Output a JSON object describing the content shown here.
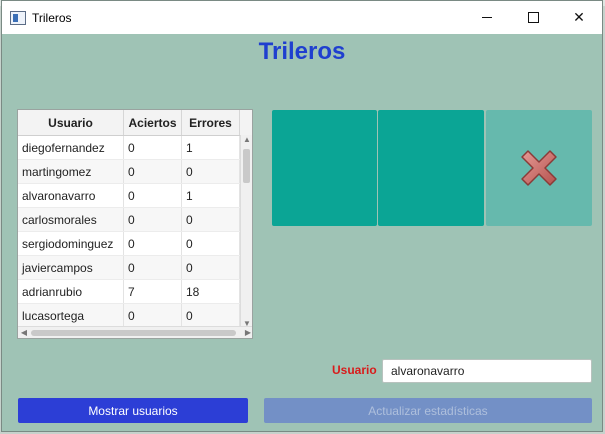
{
  "window": {
    "title": "Trileros",
    "controls": [
      "minimize",
      "maximize",
      "close"
    ]
  },
  "heading": "Trileros",
  "table": {
    "columns": [
      "Usuario",
      "Aciertos",
      "Errores"
    ],
    "rows": [
      [
        "diegofernandez",
        "0",
        "1"
      ],
      [
        "martingomez",
        "0",
        "0"
      ],
      [
        "alvaronavarro",
        "0",
        "1"
      ],
      [
        "carlosmorales",
        "0",
        "0"
      ],
      [
        "sergiodominguez",
        "0",
        "0"
      ],
      [
        "javiercampos",
        "0",
        "0"
      ],
      [
        "adrianrubio",
        "7",
        "18"
      ],
      [
        "lucasortega",
        "0",
        "0"
      ]
    ]
  },
  "cups": {
    "count": 3,
    "colors": {
      "cup": "#0ba595",
      "selected_cup": "#66b9ad",
      "mark": "#c0625e"
    },
    "selected_index": 2,
    "selected_icon": "cross-icon"
  },
  "form": {
    "user_label": "Usuario",
    "user_value": "alvaronavarro"
  },
  "buttons": {
    "show_users": "Mostrar usuarios",
    "update_stats": "Actualizar estadísticas"
  },
  "colors": {
    "background": "#9fc3b5",
    "heading": "#1f3fcf",
    "user_label": "#d81b1b",
    "primary_button": "#2c3ed6",
    "disabled_button": "#7390c6"
  }
}
